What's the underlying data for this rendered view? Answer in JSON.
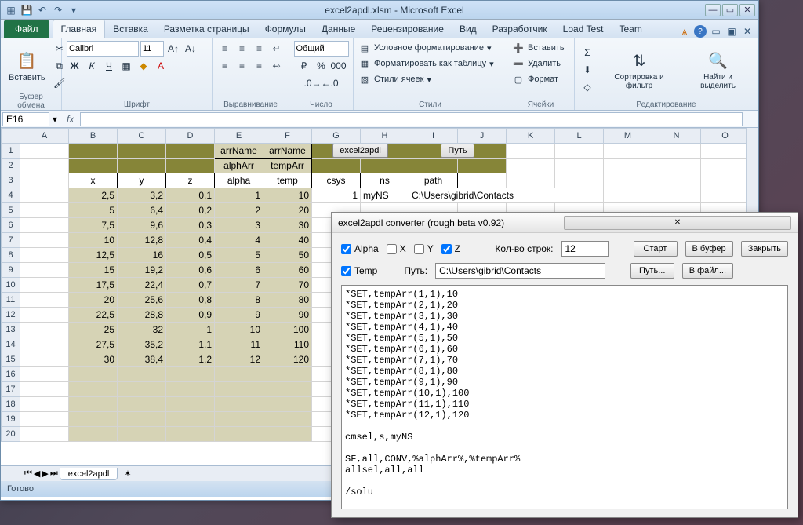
{
  "window": {
    "title": "excel2apdl.xlsm - Microsoft Excel",
    "file_tab": "Файл",
    "tabs": [
      "Главная",
      "Вставка",
      "Разметка страницы",
      "Формулы",
      "Данные",
      "Рецензирование",
      "Вид",
      "Разработчик",
      "Load Test",
      "Team"
    ],
    "active_tab": 0
  },
  "ribbon": {
    "clipboard": {
      "label": "Буфер обмена",
      "paste": "Вставить"
    },
    "font": {
      "label": "Шрифт",
      "name": "Calibri",
      "size": "11"
    },
    "alignment": {
      "label": "Выравнивание"
    },
    "number": {
      "label": "Число",
      "format": "Общий"
    },
    "styles": {
      "label": "Стили",
      "cond": "Условное форматирование",
      "table": "Форматировать как таблицу",
      "cell": "Стили ячеек"
    },
    "cells": {
      "label": "Ячейки",
      "insert": "Вставить",
      "delete": "Удалить",
      "format": "Формат"
    },
    "editing": {
      "label": "Редактирование",
      "sort": "Сортировка и фильтр",
      "find": "Найти и выделить"
    }
  },
  "formula_bar": {
    "cell_ref": "E16",
    "formula": ""
  },
  "columns": [
    "A",
    "B",
    "C",
    "D",
    "E",
    "F",
    "G",
    "H",
    "I",
    "J",
    "K",
    "L",
    "M",
    "N",
    "O"
  ],
  "rows": [
    "1",
    "2",
    "3",
    "4",
    "5",
    "6",
    "7",
    "8",
    "9",
    "10",
    "11",
    "12",
    "13",
    "14",
    "15",
    "16",
    "17",
    "18",
    "19",
    "20"
  ],
  "sheet": {
    "row1": {
      "E": "arrName",
      "F": "arrName",
      "btn1": "excel2apdl",
      "btn2": "Путь"
    },
    "row2": {
      "E": "alphArr",
      "F": "tempArr"
    },
    "headers": {
      "B": "x",
      "C": "y",
      "D": "z",
      "E": "alpha",
      "F": "temp",
      "G": "csys",
      "H": "ns",
      "I": "path"
    },
    "row4_extra": {
      "G": "1",
      "H": "myNS",
      "I": "C:\\Users\\gibrid\\Contacts"
    },
    "data": [
      {
        "x": "2,5",
        "y": "3,2",
        "z": "0,1",
        "alpha": "1",
        "temp": "10"
      },
      {
        "x": "5",
        "y": "6,4",
        "z": "0,2",
        "alpha": "2",
        "temp": "20"
      },
      {
        "x": "7,5",
        "y": "9,6",
        "z": "0,3",
        "alpha": "3",
        "temp": "30"
      },
      {
        "x": "10",
        "y": "12,8",
        "z": "0,4",
        "alpha": "4",
        "temp": "40"
      },
      {
        "x": "12,5",
        "y": "16",
        "z": "0,5",
        "alpha": "5",
        "temp": "50"
      },
      {
        "x": "15",
        "y": "19,2",
        "z": "0,6",
        "alpha": "6",
        "temp": "60"
      },
      {
        "x": "17,5",
        "y": "22,4",
        "z": "0,7",
        "alpha": "7",
        "temp": "70"
      },
      {
        "x": "20",
        "y": "25,6",
        "z": "0,8",
        "alpha": "8",
        "temp": "80"
      },
      {
        "x": "22,5",
        "y": "28,8",
        "z": "0,9",
        "alpha": "9",
        "temp": "90"
      },
      {
        "x": "25",
        "y": "32",
        "z": "1",
        "alpha": "10",
        "temp": "100"
      },
      {
        "x": "27,5",
        "y": "35,2",
        "z": "1,1",
        "alpha": "11",
        "temp": "110"
      },
      {
        "x": "30",
        "y": "38,4",
        "z": "1,2",
        "alpha": "12",
        "temp": "120"
      }
    ],
    "tab_name": "excel2apdl",
    "status": "Готово"
  },
  "dialog": {
    "title": "excel2apdl converter (rough beta v0.92)",
    "alpha": "Alpha",
    "x": "X",
    "y": "Y",
    "z": "Z",
    "temp": "Temp",
    "rows_label": "Кол-во строк:",
    "rows_value": "12",
    "path_label": "Путь:",
    "path_value": "C:\\Users\\gibrid\\Contacts",
    "btn_start": "Старт",
    "btn_buffer": "В буфер",
    "btn_close": "Закрыть",
    "btn_path": "Путь...",
    "btn_file": "В файл...",
    "output": "*SET,tempArr(1,1),10\n*SET,tempArr(2,1),20\n*SET,tempArr(3,1),30\n*SET,tempArr(4,1),40\n*SET,tempArr(5,1),50\n*SET,tempArr(6,1),60\n*SET,tempArr(7,1),70\n*SET,tempArr(8,1),80\n*SET,tempArr(9,1),90\n*SET,tempArr(10,1),100\n*SET,tempArr(11,1),110\n*SET,tempArr(12,1),120\n\ncmsel,s,myNS\n\nSF,all,CONV,%alphArr%,%tempArr%\nallsel,all,all\n\n/solu"
  }
}
